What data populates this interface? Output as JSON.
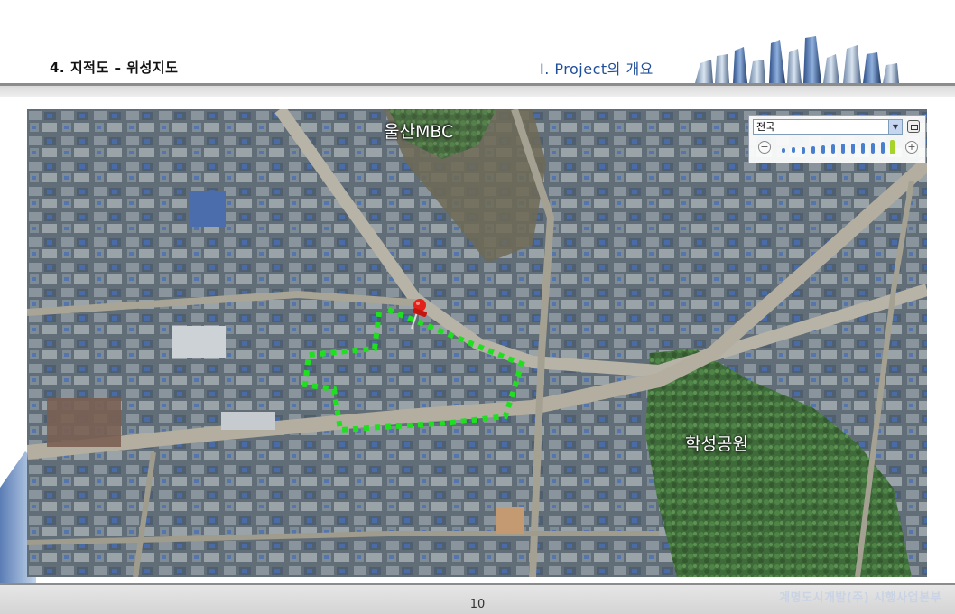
{
  "header": {
    "section_title": "4. 지적도 – 위성지도",
    "chapter_title": "Ⅰ.  Project의 개요"
  },
  "map": {
    "labels": {
      "mbc": "울산MBC",
      "park": "학성공원"
    },
    "control": {
      "region_value": "전국",
      "zoom_level_fraction": 0.92
    },
    "boundary_color": "#1fe01f",
    "pin_color": "#e3231b"
  },
  "footer": {
    "page_number": "10",
    "company": "계명도시개발(주) 시행사업본부"
  }
}
